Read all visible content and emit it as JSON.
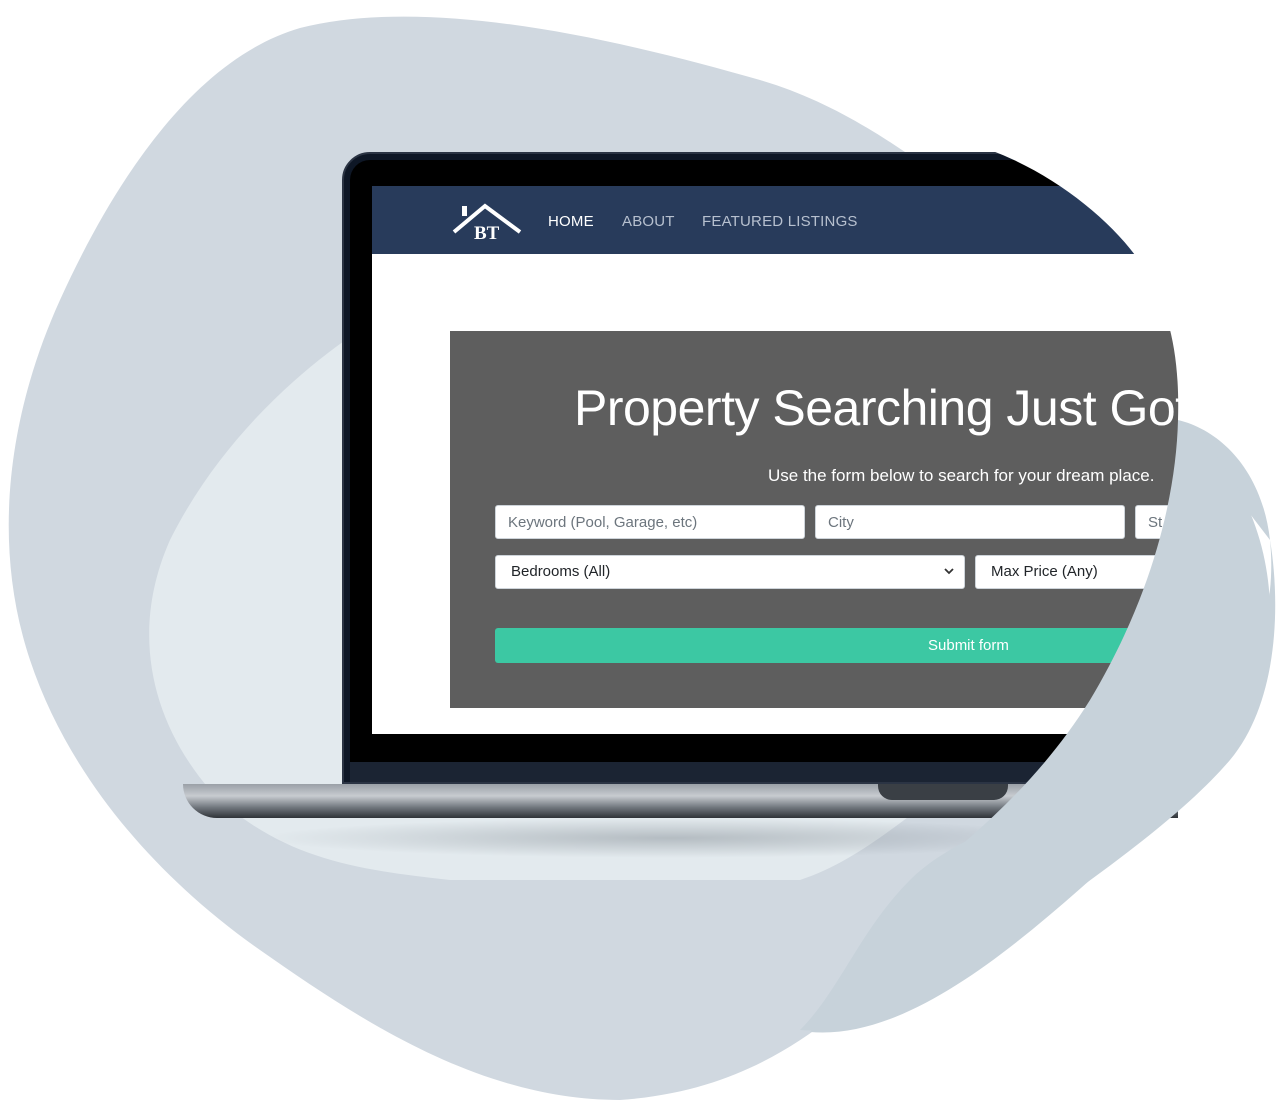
{
  "colors": {
    "blob_back": "#d0d8e0",
    "blob_light": "#e3eaee",
    "navbar": "#283b5b",
    "hero": "#5e5e5e",
    "accent": "#3cc8a3"
  },
  "logo": {
    "text": "BT",
    "icon": "house-roof-icon"
  },
  "nav": {
    "items": [
      {
        "label": "HOME",
        "active": true
      },
      {
        "label": "ABOUT",
        "active": false
      },
      {
        "label": "FEATURED LISTINGS",
        "active": false
      }
    ]
  },
  "hero": {
    "title": "Property Searching Just Got",
    "subtitle": "Use the form below to search for your dream place."
  },
  "form": {
    "keyword_placeholder": "Keyword (Pool, Garage, etc)",
    "city_placeholder": "City",
    "state_placeholder": "St",
    "bedrooms_value": "Bedrooms (All)",
    "max_price_value": "Max Price (Any)",
    "submit_label": "Submit form"
  }
}
